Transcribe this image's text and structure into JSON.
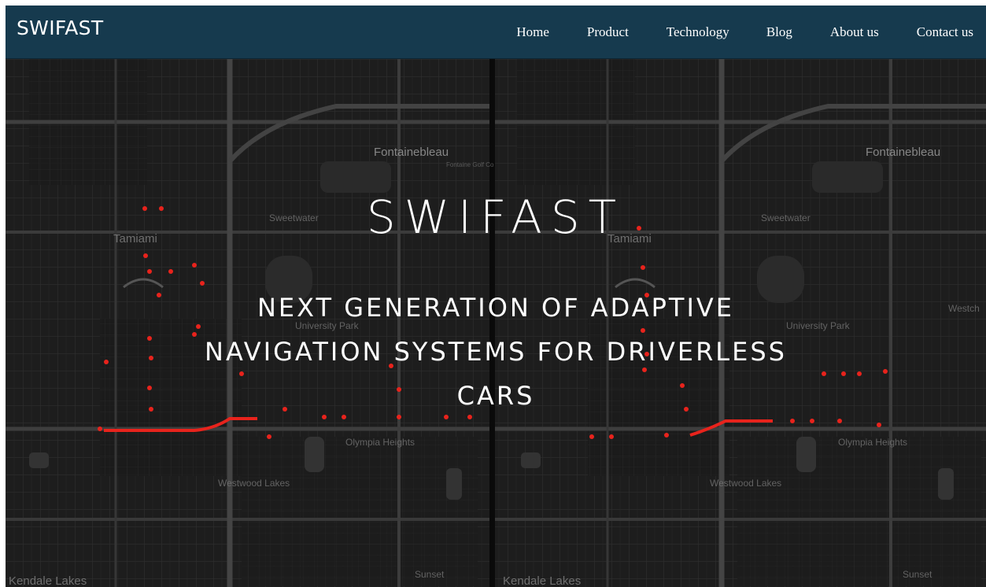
{
  "header": {
    "brand": "SWIFAST",
    "nav": [
      {
        "label": "Home"
      },
      {
        "label": "Product"
      },
      {
        "label": "Technology"
      },
      {
        "label": "Blog"
      },
      {
        "label": "About us"
      },
      {
        "label": "Contact us"
      }
    ]
  },
  "hero": {
    "title": "SWIFAST",
    "subtitle": "NEXT GENERATION OF ADAPTIVE NAVIGATION SYSTEMS FOR DRIVERLESS CARS"
  },
  "background_map": {
    "labels": {
      "fontainebleau": "Fontainebleau",
      "fontainebleau_golf": "Fontaine Golf Co",
      "sweetwater": "Sweetwater",
      "tamiami": "Tamiami",
      "university_park": "University Park",
      "olympia_heights": "Olympia Heights",
      "westwood_lakes": "Westwood Lakes",
      "sunset": "Sunset",
      "kendale_lakes": "Kendale Lakes",
      "westch": "Westch"
    },
    "route_color": "#e8231c"
  },
  "colors": {
    "navbar": "#163a4e",
    "map_background": "#1a1a1a",
    "text": "#ffffff"
  }
}
